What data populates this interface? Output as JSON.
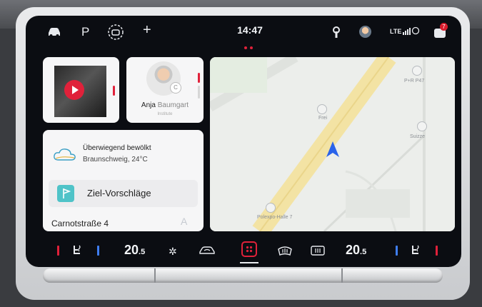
{
  "statusbar": {
    "car_icon": "car-icon",
    "park_label": "P",
    "clock": "14:47",
    "network": "LTE",
    "notification_count": "7"
  },
  "media": {
    "icon": "play-icon"
  },
  "contact": {
    "first_name": "Anja",
    "last_name": "Baumgart",
    "subtitle": "Institute",
    "badge": "C"
  },
  "weather": {
    "condition": "Überwiegend bewölkt",
    "location_temp": "Braunschweig, 24°C",
    "icon": "cloud-icon"
  },
  "suggestions": {
    "label": "Ziel-Vorschläge",
    "icon": "flag-icon"
  },
  "destination": {
    "address": "Carnotstraße 4",
    "letter": "A"
  },
  "map": {
    "labels": [
      "P+R P47",
      "Frei",
      "Suizze",
      "Polexpo-Halle 7"
    ]
  },
  "climate": {
    "left_temp_main": "20",
    "left_temp_dec": ".5",
    "right_temp_main": "20",
    "right_temp_dec": ".5"
  },
  "colors": {
    "accent": "#e0213a",
    "seat_blue": "#3f7ef2"
  }
}
